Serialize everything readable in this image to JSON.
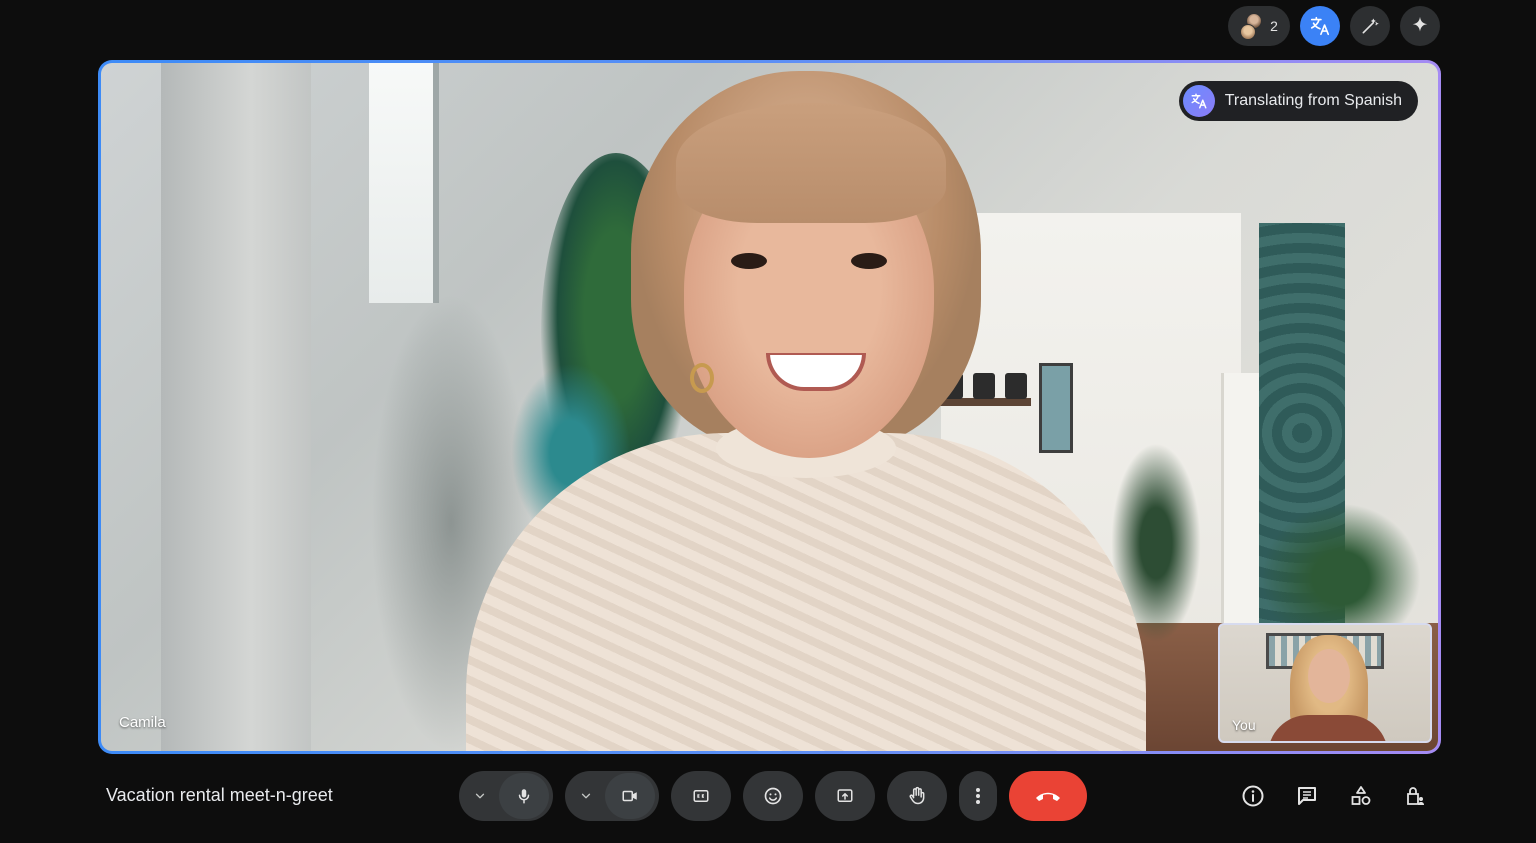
{
  "header": {
    "participant_count": "2",
    "buttons": [
      {
        "name": "people-button",
        "icon": "people-icon"
      },
      {
        "name": "translate-button",
        "icon": "translate-icon"
      },
      {
        "name": "effects-button",
        "icon": "magic-wand-icon"
      },
      {
        "name": "gemini-button",
        "icon": "sparkle-icon"
      }
    ]
  },
  "stage": {
    "speaker_name": "Camila",
    "translation_banner": "Translating from Spanish",
    "self_view_label": "You"
  },
  "meeting": {
    "title": "Vacation rental meet-n-greet"
  },
  "controls": [
    {
      "name": "mic-control",
      "icon": "microphone-icon"
    },
    {
      "name": "camera-control",
      "icon": "video-camera-icon"
    },
    {
      "name": "captions-button",
      "icon": "closed-captions-icon"
    },
    {
      "name": "reactions-button",
      "icon": "emoji-icon"
    },
    {
      "name": "present-button",
      "icon": "present-screen-icon"
    },
    {
      "name": "raise-hand-button",
      "icon": "hand-icon"
    },
    {
      "name": "more-options-button",
      "icon": "more-vert-icon"
    },
    {
      "name": "leave-call-button",
      "icon": "call-end-icon"
    }
  ],
  "right_panel_buttons": [
    {
      "name": "meeting-details-button",
      "icon": "info-icon"
    },
    {
      "name": "chat-button",
      "icon": "chat-icon"
    },
    {
      "name": "activities-button",
      "icon": "shapes-icon"
    },
    {
      "name": "host-controls-button",
      "icon": "lock-person-icon"
    }
  ],
  "colors": {
    "accent_blue": "#3b82f6",
    "end_call_red": "#ea4335",
    "stage_border_start": "#3d8bf7",
    "stage_border_end": "#a58bf3",
    "background": "#0d0d0d"
  }
}
